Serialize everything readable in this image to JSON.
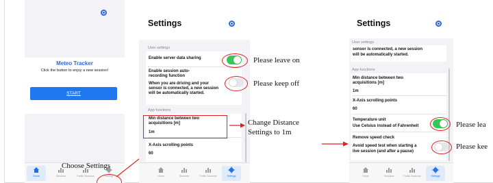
{
  "screen1": {
    "card_title": "Meteo Tracker",
    "card_subtitle": "Click the button to enjoy a new session!",
    "start_button": "START",
    "annotation": "Choose Settings"
  },
  "tabs": {
    "home": "Home",
    "sessions": "Sessions",
    "public_sessions": "Public Sessions",
    "settings": "Settings"
  },
  "screen2": {
    "title": "Settings",
    "user_settings_label": "User settings",
    "server_sharing": "Enable server data sharing",
    "auto_rec_title_1": "Enable session auto-",
    "auto_rec_title_2": "recording function",
    "auto_rec_desc_1": "When you are driving and your",
    "auto_rec_desc_2": "sensor is connected, a new session",
    "auto_rec_desc_3": "will be automatically started.",
    "app_functions_label": "App functions",
    "min_dist_1": "Min distance between two",
    "min_dist_2": "acquisitions [m]",
    "min_dist_value": "1m",
    "x_axis_label": "X-Axis scrolling points",
    "x_axis_value": "60",
    "annot_leave_on": "Please leave on",
    "annot_keep_off": "Please keep off",
    "annot_change_1": "Change Distance",
    "annot_change_2": "Settings to 1m"
  },
  "screen3": {
    "title": "Settings",
    "user_settings_label": "User settings",
    "carry_1": "sensor is connected, a new session",
    "carry_2": "will be automatically started.",
    "app_functions_label": "App functions",
    "min_dist_1": "Min distance between two",
    "min_dist_2": "acquisitions [m]",
    "min_dist_value": "1m",
    "x_axis_label": "X-Axis scrolling points",
    "x_axis_value": "60",
    "temp_unit": "Temperature unit",
    "temp_unit_desc": "Use Celsius instead of Fahrenheit",
    "speed_check": "Remove speed check",
    "speed_desc_1": "Avoid speed test when starting a",
    "speed_desc_2": "live session (and after a pause)",
    "annot_leave": "Please lea",
    "annot_keep": "Please kee"
  },
  "colors": {
    "accent_blue": "#2b67e0",
    "toggle_green": "#34c759",
    "annotation_red": "#e02020"
  },
  "icons": [
    "profile-icon",
    "home-icon",
    "sessions-icon",
    "public-sessions-icon",
    "gear-icon"
  ]
}
